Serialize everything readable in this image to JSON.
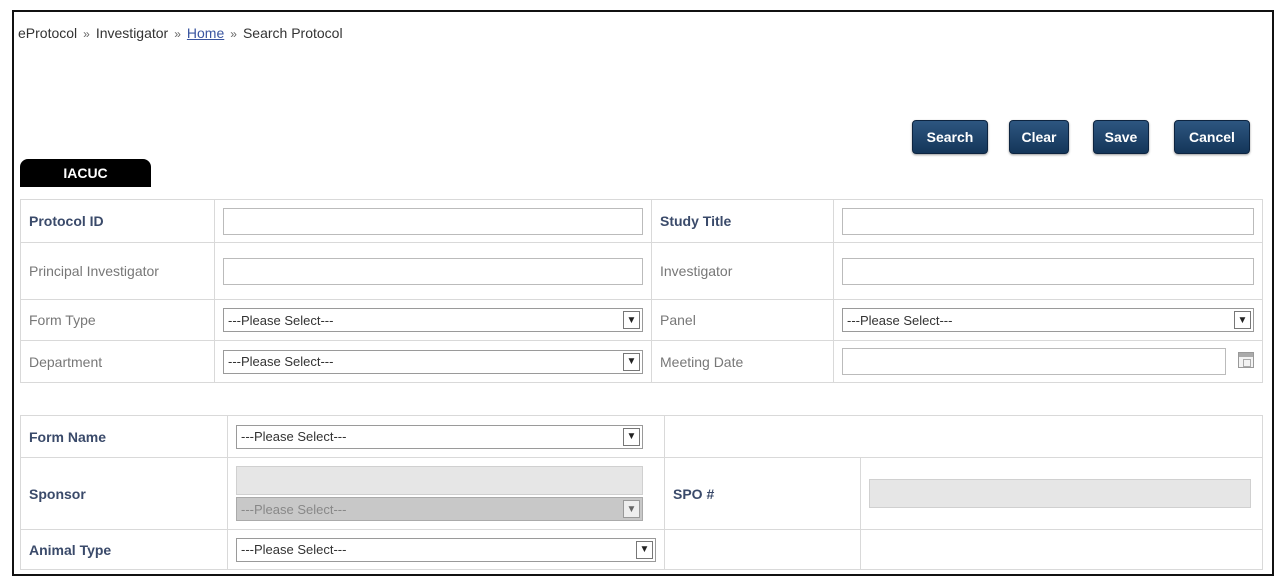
{
  "breadcrumb": {
    "items": [
      "eProtocol",
      "Investigator",
      "Home",
      "Search Protocol"
    ],
    "separator": "»"
  },
  "toolbar": {
    "search_label": "Search",
    "clear_label": "Clear",
    "save_label": "Save",
    "cancel_label": "Cancel"
  },
  "tab": {
    "label": "IACUC"
  },
  "form1": {
    "protocol_id_label": "Protocol ID",
    "protocol_id_value": "",
    "study_title_label": "Study Title",
    "study_title_value": "",
    "pi_label": "Principal Investigator",
    "pi_value": "",
    "investigator_label": "Investigator",
    "investigator_value": "",
    "form_type_label": "Form Type",
    "form_type_value": "---Please Select---",
    "panel_label": "Panel",
    "panel_value": "---Please Select---",
    "department_label": "Department",
    "department_value": "---Please Select---",
    "meeting_date_label": "Meeting Date",
    "meeting_date_value": ""
  },
  "form2": {
    "form_name_label": "Form Name",
    "form_name_value": "---Please Select---",
    "sponsor_label": "Sponsor",
    "sponsor_value": "---Please Select---",
    "spo_label": "SPO #",
    "animal_type_label": "Animal Type",
    "animal_type_value": "---Please Select---"
  },
  "colors": {
    "button_bg": "#1e4470",
    "tab_bg": "#000000",
    "label_bold": "#3a4a6a",
    "link": "#3a55a0"
  }
}
